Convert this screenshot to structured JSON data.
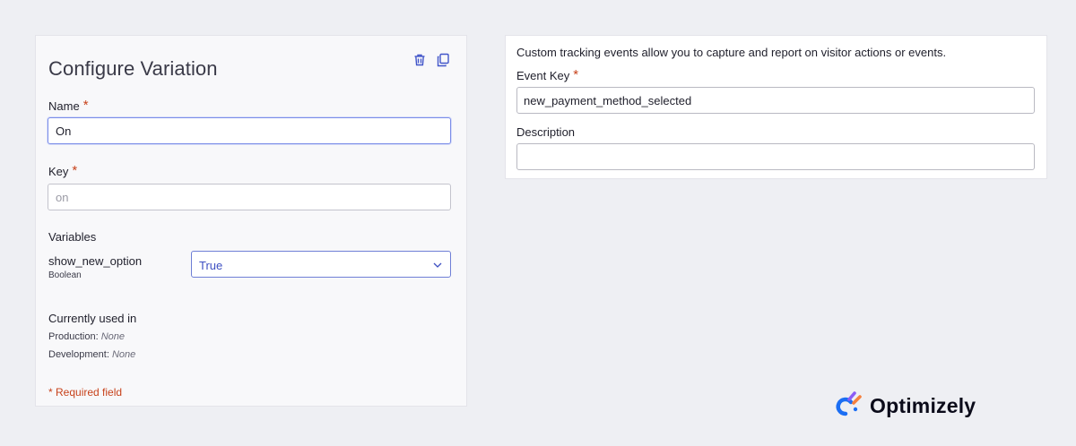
{
  "variation_panel": {
    "title": "Configure Variation",
    "icons": {
      "delete": "trash-icon",
      "duplicate": "copy-icon"
    },
    "name_field": {
      "label": "Name",
      "required_mark": "*",
      "value": "On"
    },
    "key_field": {
      "label": "Key",
      "required_mark": "*",
      "value": "",
      "placeholder": "on"
    },
    "variables": {
      "heading": "Variables",
      "items": [
        {
          "name": "show_new_option",
          "type": "Boolean",
          "selected": "True"
        }
      ]
    },
    "usage": {
      "heading": "Currently used in",
      "environments": [
        {
          "label": "Production:",
          "value": "None"
        },
        {
          "label": "Development:",
          "value": "None"
        }
      ]
    },
    "required_note": "* Required field"
  },
  "event_panel": {
    "description": "Custom tracking events allow you to capture and report on visitor actions or events.",
    "event_key": {
      "label": "Event Key",
      "required_mark": "*",
      "value": "new_payment_method_selected"
    },
    "description_field": {
      "label": "Description",
      "value": ""
    }
  },
  "branding": {
    "logo_text": "Optimizely"
  },
  "colors": {
    "accent": "#3d4fc2",
    "focus_border": "#7b8de8",
    "required": "#c7421b",
    "background": "#eeeff3"
  }
}
